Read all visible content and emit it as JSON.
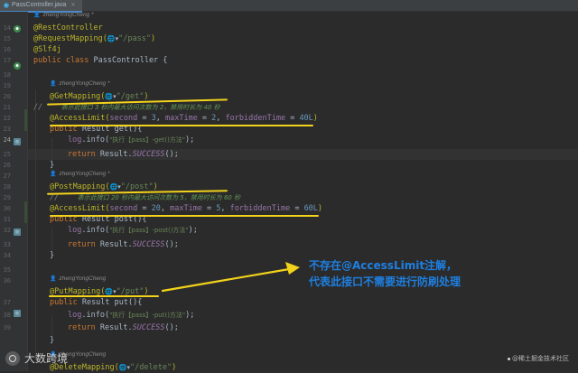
{
  "tab": {
    "file_name": "PassController.java"
  },
  "author_hint": "zhengYongCheng *",
  "author_hint2": "zhengYongCheng",
  "gutter": {
    "line_numbers": [
      "14",
      "15",
      "16",
      "17",
      "18",
      "19",
      "20",
      "21",
      "22",
      "23",
      "24",
      "25",
      "26",
      "27",
      "28",
      "29",
      "30",
      "31",
      "32",
      "33",
      "34",
      "35",
      "36",
      "37",
      "38",
      "39"
    ],
    "current_line": "24"
  },
  "code": {
    "l14": {
      "ann": "@RestController"
    },
    "l15": {
      "ann": "@RequestMapping(",
      "path": "\"/pass\"",
      "close": ")"
    },
    "l16": {
      "ann": "@Slf4j"
    },
    "l17": {
      "kw": "public class ",
      "name": "PassController {"
    },
    "l20": {
      "ann": "@GetMapping(",
      "path": "\"/get\"",
      "close": ")"
    },
    "l21": {
      "prefix": "//    ",
      "comment": "表示此接口 3 秒内最大访问次数为 2，禁用时长为 40 秒"
    },
    "l22": {
      "ann": "@AccessLimit(",
      "p1": "second",
      "v1": "3",
      "p2": "maxTime",
      "v2": "2",
      "p3": "forbiddenTime",
      "v3": "40L",
      "close": ")"
    },
    "l23": {
      "kw": "public ",
      "sig": "Result get(){"
    },
    "l24": {
      "obj": "log",
      "call": ".info(",
      "str": "\"执行【pass】-get()方法\"",
      "end": ");"
    },
    "l25": {
      "kw": "return ",
      "cls": "Result.",
      "em": "SUCCESS",
      "end": "();"
    },
    "l26": {
      "text": "}"
    },
    "l28": {
      "ann": "@PostMapping(",
      "path": "\"/post\"",
      "close": ")"
    },
    "l29": {
      "prefix": "//    ",
      "comment": "表示此接口 20 秒内最大访问次数为 5，禁用时长为 60 秒"
    },
    "l30": {
      "ann": "@AccessLimit(",
      "p1": "second",
      "v1": "20",
      "p2": "maxTime",
      "v2": "5",
      "p3": "forbiddenTime",
      "v3": "60L",
      "close": ")"
    },
    "l31": {
      "kw": "public ",
      "sig": "Result post(){"
    },
    "l32": {
      "obj": "log",
      "call": ".info(",
      "str": "\"执行【pass】-post()方法\"",
      "end": ");"
    },
    "l33": {
      "kw": "return ",
      "cls": "Result.",
      "em": "SUCCESS",
      "end": "();"
    },
    "l34": {
      "text": "}"
    },
    "l36": {
      "ann": "@PutMapping(",
      "path": "\"/put\"",
      "close": ")"
    },
    "l37": {
      "kw": "public ",
      "sig": "Result put(){"
    },
    "l38": {
      "obj": "log",
      "call": ".info(",
      "str": "\"执行【pass】-put()方法\"",
      "end": ");"
    },
    "l39": {
      "kw": "return ",
      "cls": "Result.",
      "em": "SUCCESS",
      "end": "();"
    },
    "l40": {
      "text": "}"
    },
    "l42": {
      "ann": "@DeleteMapping(",
      "path": "\"/delete\"",
      "close": ")"
    }
  },
  "callout": {
    "line1": "不存在@AccessLimit注解，",
    "line2": "代表此接口不需要进行防刷处理",
    "color": "#1e7fe0"
  },
  "underline_color": "#f2d21a",
  "brand": {
    "name": "大数跨境"
  },
  "watermark": "@稀土掘金技术社区"
}
